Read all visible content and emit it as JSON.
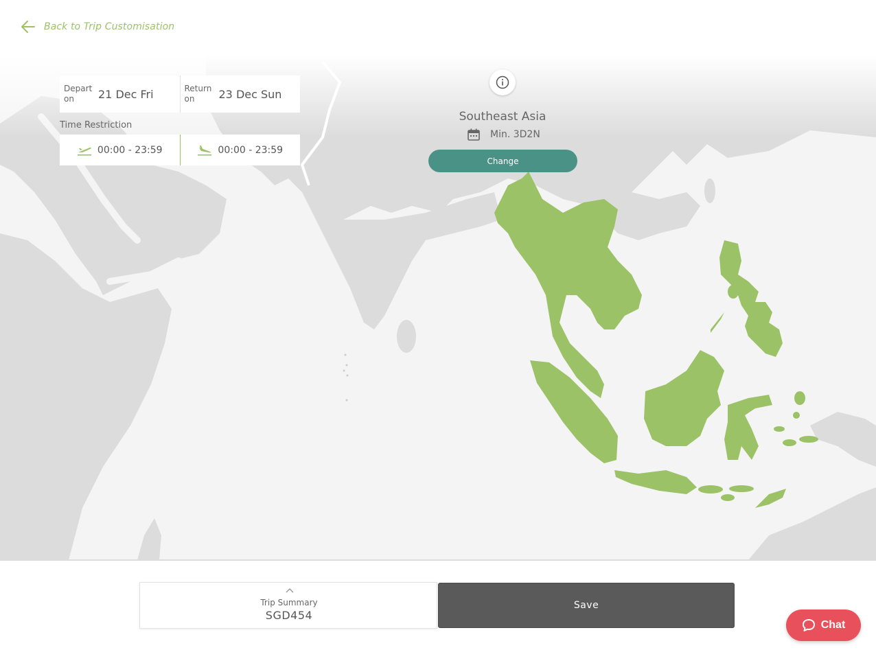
{
  "nav": {
    "back_label": "Back to Trip Customisation"
  },
  "dates": {
    "depart_caption": "Depart on",
    "depart_value": "21 Dec Fri",
    "return_caption": "Return on",
    "return_value": "23 Dec Sun"
  },
  "time_restriction": {
    "title": "Time Restriction",
    "departure_range": "00:00 - 23:59",
    "arrival_range": "00:00 - 23:59"
  },
  "region": {
    "name": "Southeast Asia",
    "min_duration": "Min. 3D2N",
    "change_label": "Change"
  },
  "summary": {
    "label": "Trip Summary",
    "price": "SGD454"
  },
  "actions": {
    "save_label": "Save",
    "chat_label": "Chat"
  },
  "colors": {
    "accent_green": "#9cc267",
    "teal": "#4a9186",
    "land_grey": "#dcdcdc",
    "sea": "#f4f4f4",
    "save_dark": "#5a5a5a",
    "chat_red": "#e8505b"
  },
  "icons": [
    "arrow-left-icon",
    "info-icon",
    "calendar-icon",
    "plane-takeoff-icon",
    "plane-landing-icon",
    "chevron-up-icon",
    "chat-bubble-icon"
  ]
}
